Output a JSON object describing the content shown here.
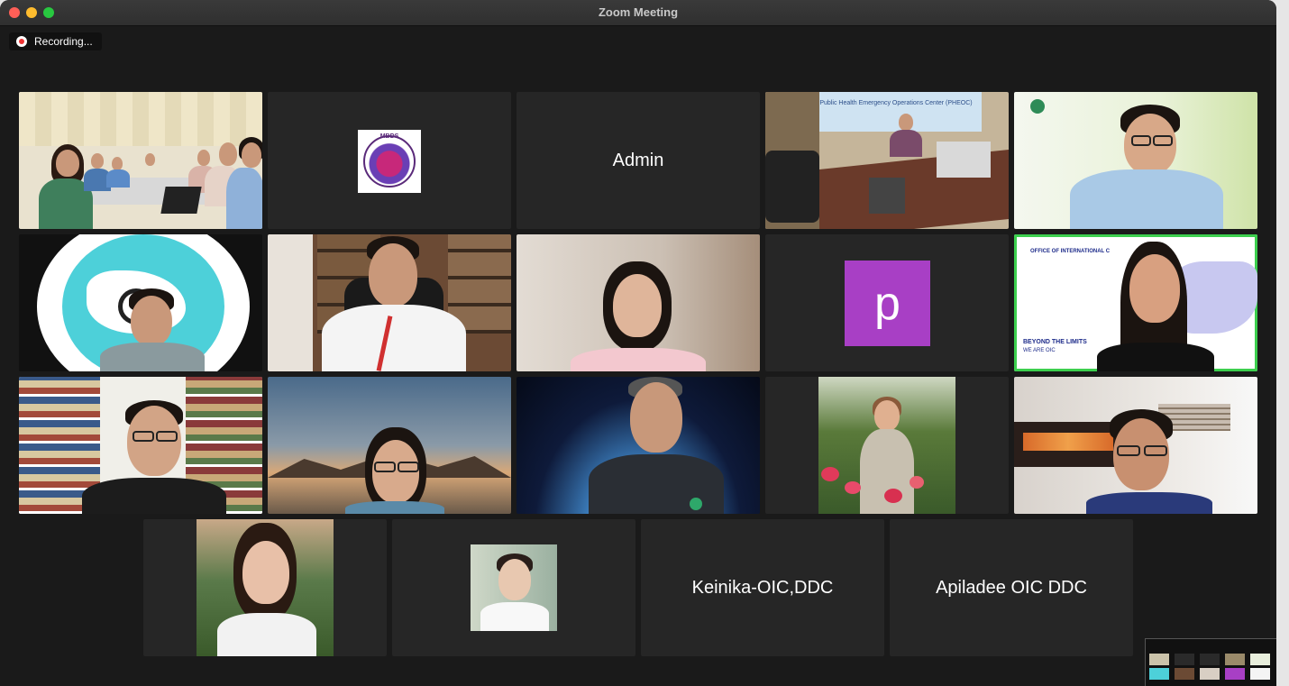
{
  "window": {
    "title": "Zoom Meeting"
  },
  "recording": {
    "label": "Recording..."
  },
  "participants": {
    "admin": "Admin",
    "keinika": "Keinika-OIC,DDC",
    "apiladee": "Apiladee OIC DDC",
    "p_avatar": "p"
  },
  "pheoc_banner": "Public Health Emergency Operations Center (PHEOC)",
  "oic_banner": {
    "top": "OFFICE OF INTERNATIONAL C",
    "tag1": "BEYOND THE LIMITS",
    "tag2": "WE ARE OIC"
  },
  "mbds_logo": "MBDS"
}
